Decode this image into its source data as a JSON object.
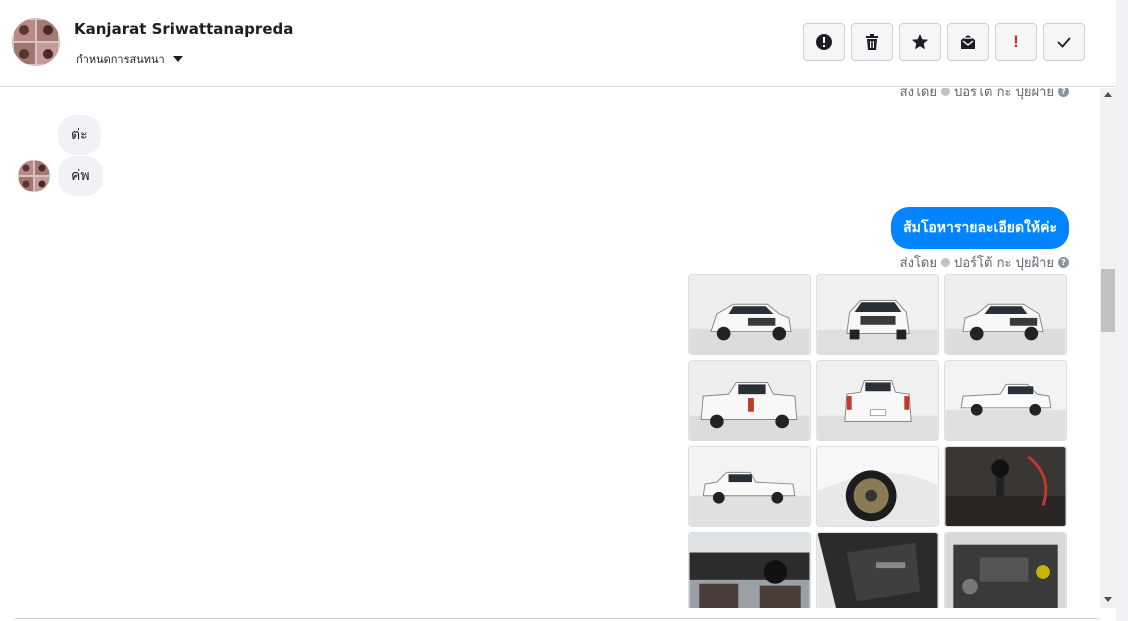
{
  "header": {
    "contact_name": "Kanjarat Sriwattanapreda",
    "subtitle": "กำหนดการสนทนา",
    "toolbar": [
      {
        "icon": "alert-circle-icon",
        "name": "mark-spam-button"
      },
      {
        "icon": "trash-icon",
        "name": "delete-button"
      },
      {
        "icon": "star-icon",
        "name": "star-button"
      },
      {
        "icon": "mark-unread-icon",
        "name": "mark-unread-button"
      },
      {
        "icon": "exclamation-icon",
        "name": "important-button"
      },
      {
        "icon": "checkmark-icon",
        "name": "done-button"
      }
    ]
  },
  "conversation": {
    "top_sent_by": "ส่งโดย",
    "top_sender": "ปอร์โต้ กะ ปุยฝ้าย",
    "incoming": [
      "ต่ะ",
      "ค่พ"
    ],
    "outgoing_text": "ส้มโอหารายละเอียดให้ค่ะ",
    "sent_by_label": "ส่งโดย",
    "sender_name": "ปอร์โต้ กะ ปุยฝ้าย",
    "help_symbol": "?",
    "photos": [
      {
        "view": "front-left"
      },
      {
        "view": "front"
      },
      {
        "view": "front-right"
      },
      {
        "view": "rear-left"
      },
      {
        "view": "rear"
      },
      {
        "view": "side-right"
      },
      {
        "view": "side-left"
      },
      {
        "view": "wheel"
      },
      {
        "view": "gear-shift"
      },
      {
        "view": "dashboard"
      },
      {
        "view": "door-panel"
      },
      {
        "view": "engine"
      }
    ]
  },
  "colors": {
    "accent": "#0084ff",
    "bubble_in": "#f0f2f5",
    "alert_red": "#e02424"
  }
}
